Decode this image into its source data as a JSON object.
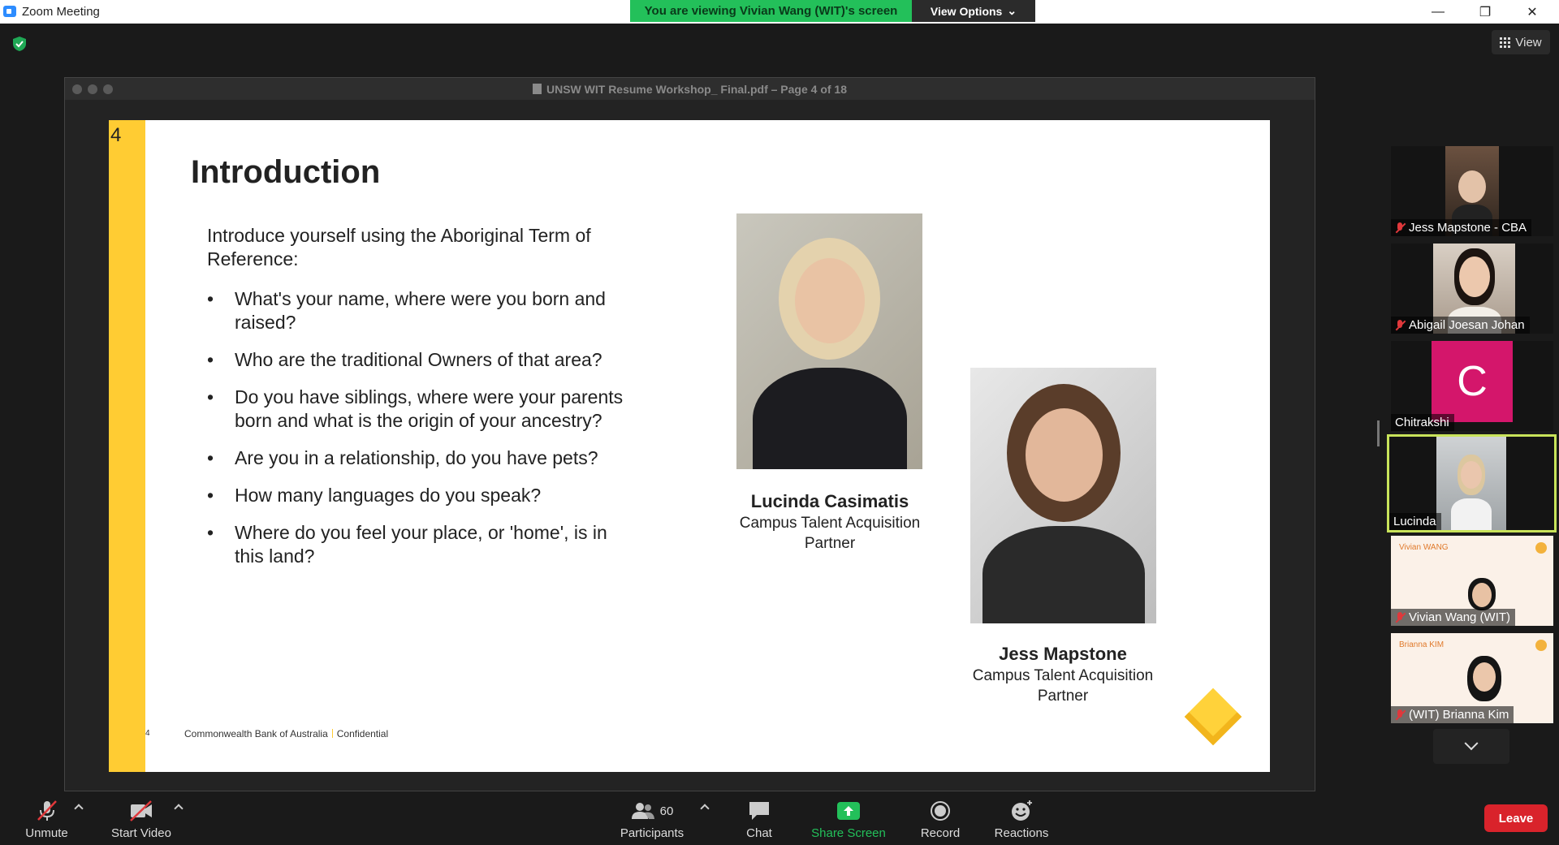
{
  "window": {
    "title": "Zoom Meeting",
    "minimize_glyph": "—",
    "restore_glyph": "❐",
    "close_glyph": "✕"
  },
  "share_banner": {
    "viewing_text": "You are viewing Vivian Wang (WIT)'s screen",
    "view_options_label": "View Options",
    "view_options_caret": "⌄"
  },
  "view_button": {
    "label": "View"
  },
  "shared_doc": {
    "title": "UNSW WIT Resume Workshop_ Final.pdf – Page 4 of 18"
  },
  "slide": {
    "number": "4",
    "title": "Introduction",
    "intro": "Introduce yourself using the Aboriginal Term of Reference:",
    "bullets": [
      "What's your name, where were you born and raised?",
      "Who are the traditional Owners of that area?",
      "Do you have siblings, where were your parents born and what is the origin of your ancestry?",
      "Are you in a relationship, do you have pets?",
      "How many languages do you speak?",
      "Where do you feel your place, or 'home', is in this land?"
    ],
    "people": [
      {
        "name": "Lucinda Casimatis",
        "role": "Campus Talent Acquisition Partner"
      },
      {
        "name": "Jess Mapstone",
        "role": "Campus Talent Acquisition Partner"
      }
    ],
    "footer_number": "4",
    "footer_company": "Commonwealth Bank of Australia",
    "footer_label": "Confidential"
  },
  "participants_strip": [
    {
      "name": "Jess Mapstone - CBA",
      "muted": true
    },
    {
      "name": "Abigail Joesan Johan",
      "muted": true
    },
    {
      "name": "Chitrakshi",
      "muted": false,
      "avatar_letter": "C",
      "avatar_color": "#d4166b"
    },
    {
      "name": "Lucinda",
      "muted": false,
      "active_speaker": true
    },
    {
      "name": "Vivian Wang (WIT)",
      "muted": true,
      "slide_title": "Vivian WANG"
    },
    {
      "name": "(WIT) Brianna Kim",
      "muted": true,
      "slide_title": "Brianna KIM"
    }
  ],
  "toolbar": {
    "unmute_label": "Unmute",
    "start_video_label": "Start Video",
    "participants_label": "Participants",
    "participants_count": "60",
    "chat_label": "Chat",
    "share_screen_label": "Share Screen",
    "record_label": "Record",
    "reactions_label": "Reactions",
    "leave_label": "Leave"
  },
  "colors": {
    "banner_green": "#23c05a",
    "share_green": "#23c05a",
    "leave_red": "#d9232b",
    "active_speaker_border": "#c8e35a",
    "slide_accent_yellow": "#ffcc33",
    "muted_red": "#e0383b"
  }
}
